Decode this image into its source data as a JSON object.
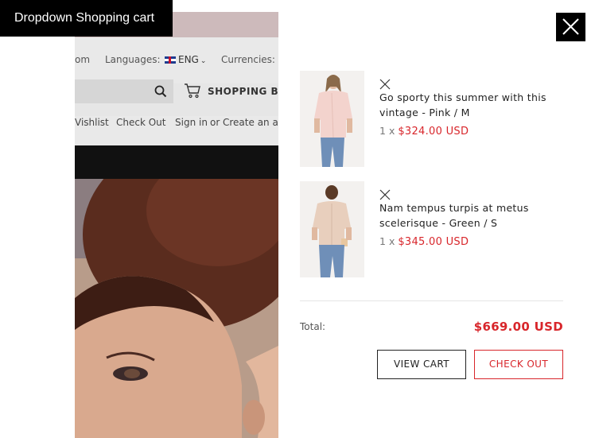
{
  "caption": "Dropdown Shopping cart",
  "background_page": {
    "domain_fragment": "om",
    "languages_label": "Languages:",
    "language_value": "ENG",
    "currencies_label": "Currencies:",
    "shopping_bag_label": "SHOPPING BA",
    "links": {
      "wishlist": "Vishlist",
      "checkout": "Check Out",
      "signin": "Sign in",
      "or": "or",
      "create": "Create an ac"
    }
  },
  "cart": {
    "items": [
      {
        "name": "Go sporty this summer with this vintage - Pink / M",
        "quantity": "1",
        "times": "x",
        "price": "$324.00 USD",
        "image_icon": "pink-blouse-model-photo"
      },
      {
        "name": "Nam tempus turpis at metus scelerisque - Green / S",
        "quantity": "1",
        "times": "x",
        "price": "$345.00 USD",
        "image_icon": "beige-top-back-view-photo"
      }
    ],
    "total_label": "Total:",
    "total_value": "$669.00 USD",
    "view_cart_label": "VIEW CART",
    "checkout_label": "CHECK OUT"
  },
  "colors": {
    "accent": "#d8262b",
    "close_button": "#000000",
    "topbar": "#cdbabb"
  }
}
